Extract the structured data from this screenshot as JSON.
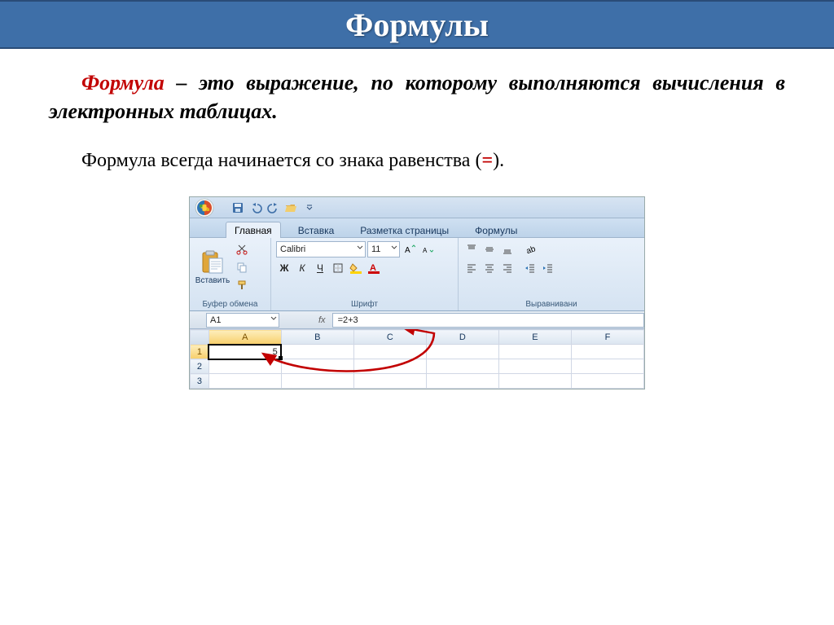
{
  "slide": {
    "title": "Формулы",
    "definition_term": "Формула",
    "definition_rest": " – это выражение, по которому выполняются вычисления в электронных таблицах.",
    "note_before": "Формула всегда начинается со знака равенства (",
    "note_eq": "=",
    "note_after": ")."
  },
  "excel": {
    "qat": {
      "save": "save",
      "undo": "undo",
      "redo": "redo",
      "open": "open"
    },
    "tabs": {
      "home": "Главная",
      "insert": "Вставка",
      "page_layout": "Разметка страницы",
      "formulas": "Формулы"
    },
    "ribbon": {
      "clipboard": {
        "label": "Буфер обмена",
        "paste": "Вставить"
      },
      "font": {
        "label": "Шрифт",
        "name": "Calibri",
        "size": "11",
        "bold": "Ж",
        "italic": "К",
        "underline": "Ч"
      },
      "alignment": {
        "label": "Выравнивани"
      }
    },
    "fbar": {
      "name": "A1",
      "fx": "fx",
      "formula": "=2+3"
    },
    "grid": {
      "cols": [
        "A",
        "B",
        "C",
        "D",
        "E",
        "F"
      ],
      "rows": [
        "1",
        "2",
        "3"
      ],
      "a1_value": "5"
    }
  }
}
